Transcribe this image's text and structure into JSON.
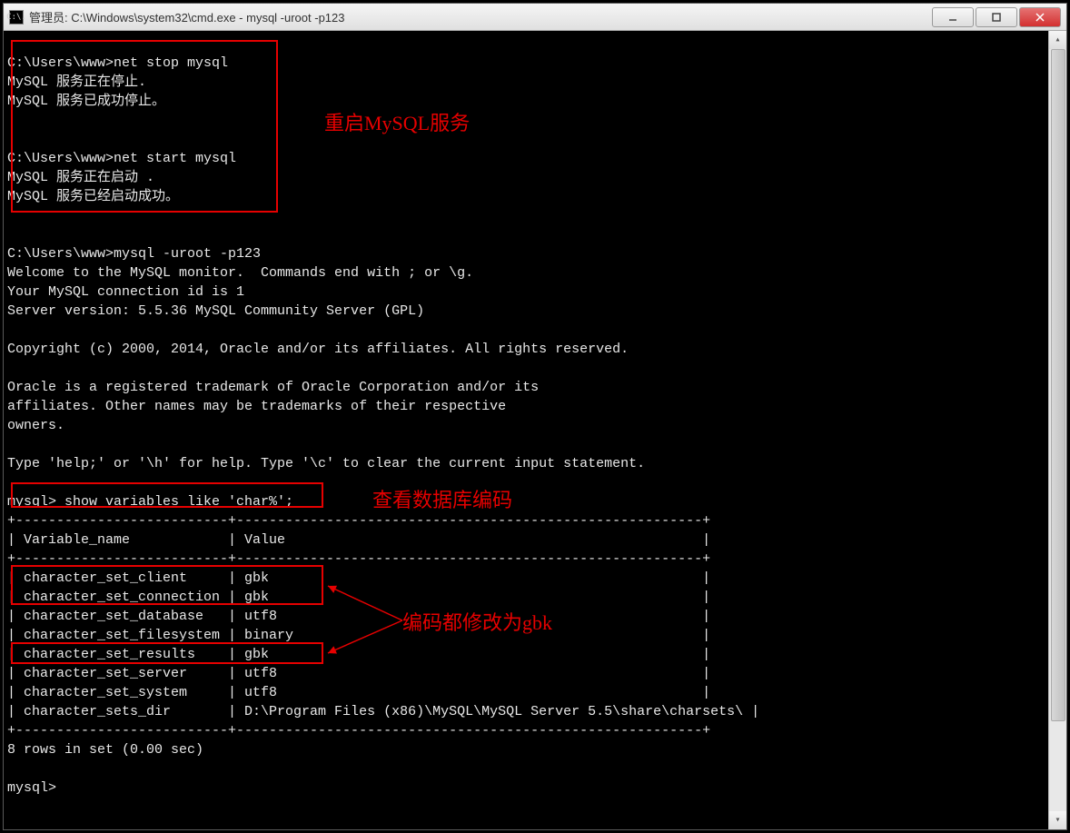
{
  "window": {
    "icon_text": "C:\\.",
    "title": "管理员: C:\\Windows\\system32\\cmd.exe - mysql  -uroot -p123"
  },
  "annotations": {
    "label_restart": "重启MySQL服务",
    "label_show": "查看数据库编码",
    "label_gbk": "编码都修改为gbk"
  },
  "terminal": {
    "lines": [
      "",
      "C:\\Users\\www>net stop mysql",
      "MySQL 服务正在停止.",
      "MySQL 服务已成功停止。",
      "",
      "",
      "C:\\Users\\www>net start mysql",
      "MySQL 服务正在启动 .",
      "MySQL 服务已经启动成功。",
      "",
      "",
      "C:\\Users\\www>mysql -uroot -p123",
      "Welcome to the MySQL monitor.  Commands end with ; or \\g.",
      "Your MySQL connection id is 1",
      "Server version: 5.5.36 MySQL Community Server (GPL)",
      "",
      "Copyright (c) 2000, 2014, Oracle and/or its affiliates. All rights reserved.",
      "",
      "Oracle is a registered trademark of Oracle Corporation and/or its",
      "affiliates. Other names may be trademarks of their respective",
      "owners.",
      "",
      "Type 'help;' or '\\h' for help. Type '\\c' to clear the current input statement.",
      "",
      "mysql> show variables like 'char%';",
      "+--------------------------+---------------------------------------------------------+",
      "| Variable_name            | Value                                                   |",
      "+--------------------------+---------------------------------------------------------+",
      "| character_set_client     | gbk                                                     |",
      "| character_set_connection | gbk                                                     |",
      "| character_set_database   | utf8                                                    |",
      "| character_set_filesystem | binary                                                  |",
      "| character_set_results    | gbk                                                     |",
      "| character_set_server     | utf8                                                    |",
      "| character_set_system     | utf8                                                    |",
      "| character_sets_dir       | D:\\Program Files (x86)\\MySQL\\MySQL Server 5.5\\share\\charsets\\ |",
      "+--------------------------+---------------------------------------------------------+",
      "8 rows in set (0.00 sec)",
      "",
      "mysql>"
    ]
  },
  "chart_data": {
    "type": "table",
    "title": "show variables like 'char%'",
    "columns": [
      "Variable_name",
      "Value"
    ],
    "rows": [
      [
        "character_set_client",
        "gbk"
      ],
      [
        "character_set_connection",
        "gbk"
      ],
      [
        "character_set_database",
        "utf8"
      ],
      [
        "character_set_filesystem",
        "binary"
      ],
      [
        "character_set_results",
        "gbk"
      ],
      [
        "character_set_server",
        "utf8"
      ],
      [
        "character_set_system",
        "utf8"
      ],
      [
        "character_sets_dir",
        "D:\\Program Files (x86)\\MySQL\\MySQL Server 5.5\\share\\charsets\\"
      ]
    ],
    "footer": "8 rows in set (0.00 sec)"
  }
}
